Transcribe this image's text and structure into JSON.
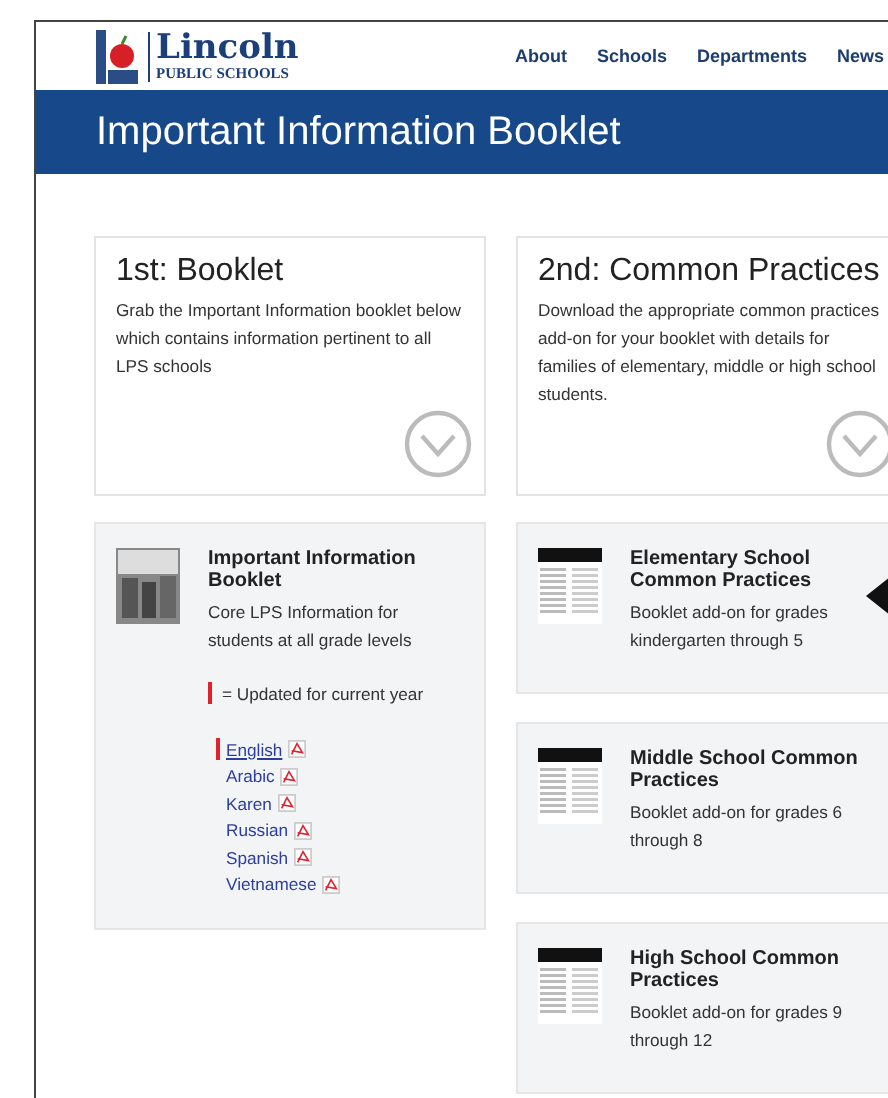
{
  "header": {
    "logo": {
      "name": "Lincoln",
      "subtitle": "PUBLIC SCHOOLS"
    },
    "nav": [
      "About",
      "Schools",
      "Departments",
      "News"
    ]
  },
  "banner": {
    "title": "Important Information Booklet"
  },
  "steps": [
    {
      "title": "1st: Booklet",
      "description_lines": [
        "Grab the Important Information booklet below",
        "which contains information pertinent to all",
        "LPS schools"
      ]
    },
    {
      "title": "2nd: Common Practices",
      "description_lines": [
        "Download the appropriate common practices",
        "add-on for your booklet with details for",
        "families of elementary, middle or high school",
        "students."
      ]
    }
  ],
  "main_booklet": {
    "title": "Important Information Booklet",
    "description": "Core LPS Information for students at all grade levels",
    "legend": "= Updated for current year",
    "languages": [
      {
        "label": "English",
        "updated": true
      },
      {
        "label": "Arabic",
        "updated": false
      },
      {
        "label": "Karen",
        "updated": false
      },
      {
        "label": "Russian",
        "updated": false
      },
      {
        "label": "Spanish",
        "updated": false
      },
      {
        "label": "Vietnamese",
        "updated": false
      }
    ]
  },
  "addons": [
    {
      "title": "Elementary School Common Practices",
      "description": "Booklet add-on for grades kindergarten through 5",
      "selected": true
    },
    {
      "title": "Middle School Common Practices",
      "description": "Booklet add-on for grades 6 through 8",
      "selected": false
    },
    {
      "title": "High School Common Practices",
      "description": "Booklet add-on for grades 9 through 12",
      "selected": false
    }
  ]
}
